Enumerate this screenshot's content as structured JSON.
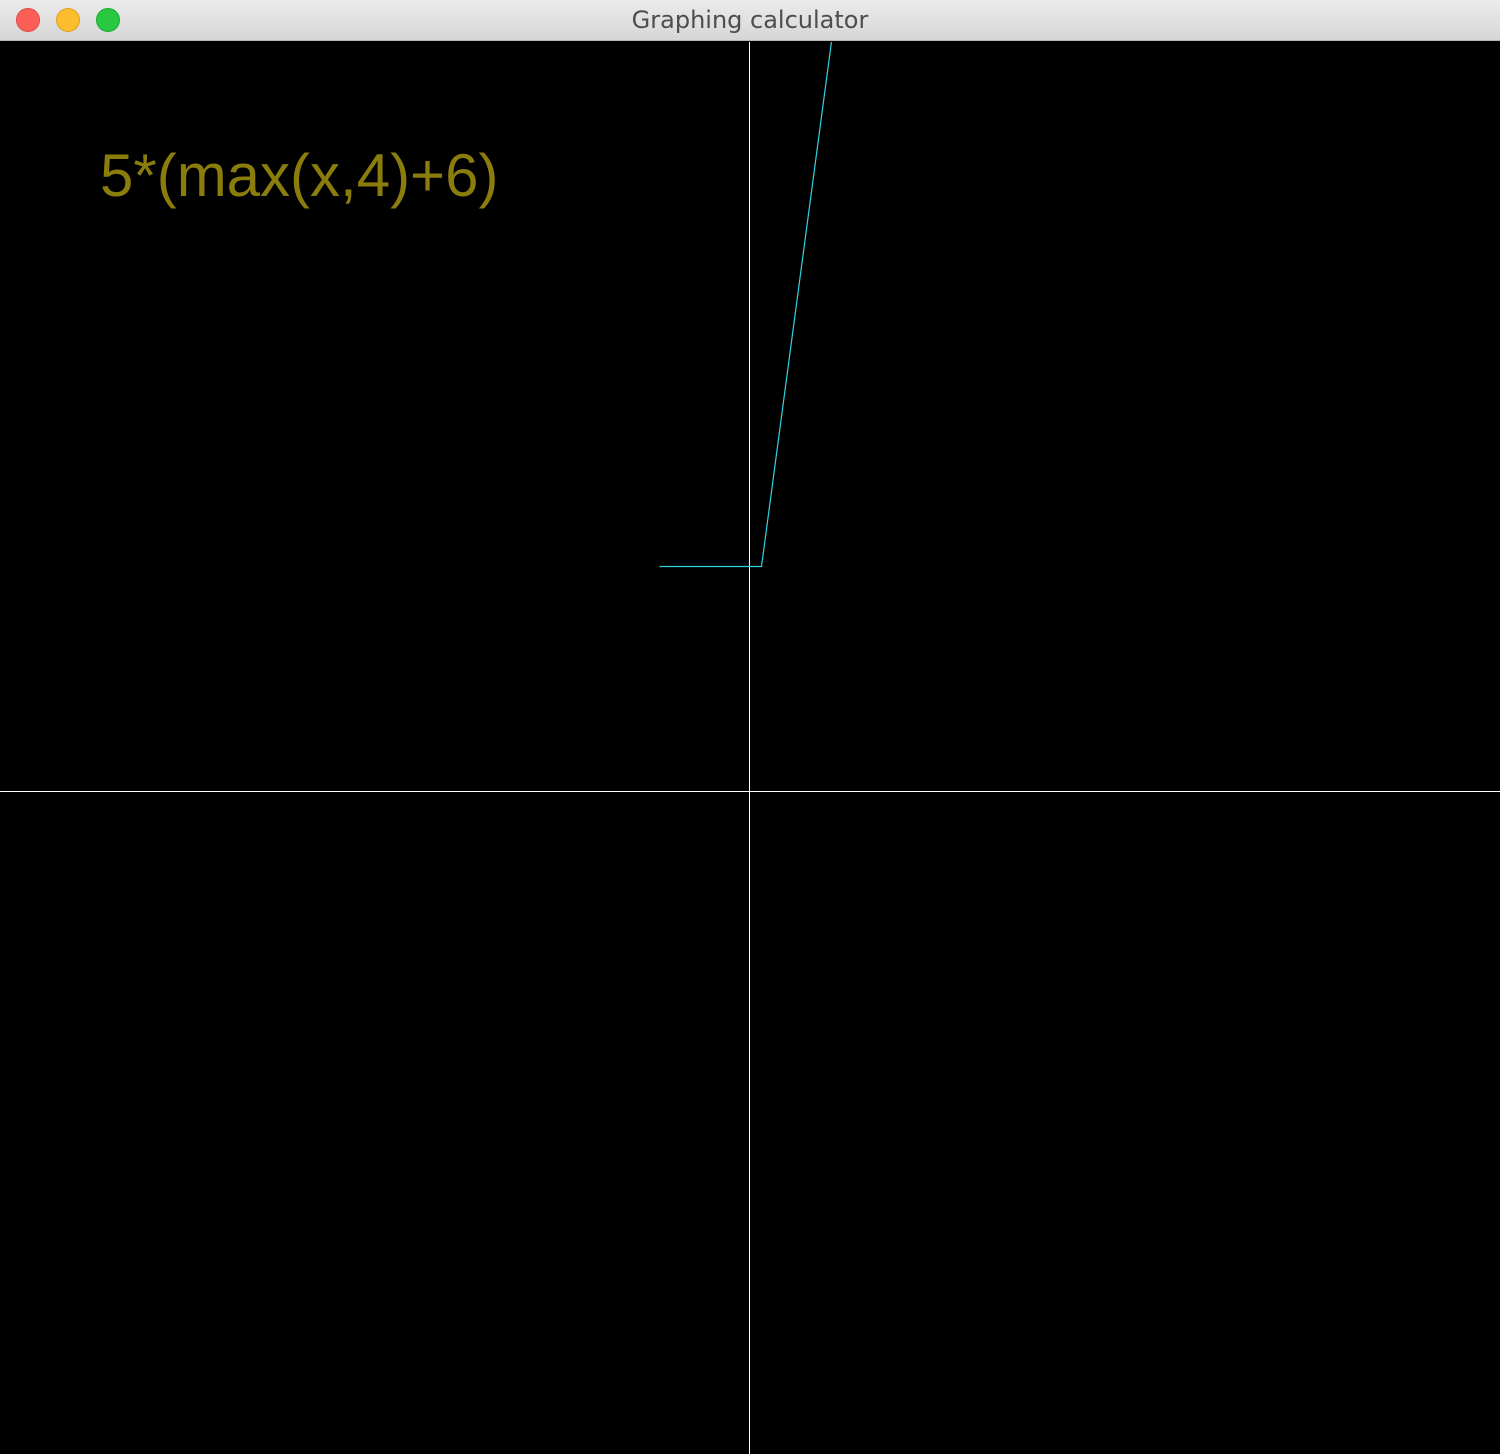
{
  "window": {
    "title": "Graphing calculator"
  },
  "graph": {
    "expression": "5*(max(x,4)+6)",
    "expression_color": "#8a7d0c",
    "curve_color": "#2fd3df",
    "axis_color": "#ffffff",
    "background_color": "#000000"
  },
  "chart_data": {
    "type": "line",
    "title": "5*(max(x,4)+6)",
    "xlabel": "",
    "ylabel": "",
    "grid": false,
    "series": [
      {
        "x": [
          -30,
          -29,
          -28,
          -27,
          -26,
          -25,
          -24,
          -23,
          -22,
          -21,
          -20,
          -19,
          -18,
          -17,
          -16,
          -15,
          -14,
          -13,
          -12,
          -11,
          -10,
          -9,
          -8,
          -7,
          -6,
          -5,
          -4,
          -3,
          -2,
          -1,
          0,
          1,
          2,
          3,
          4,
          5,
          6,
          7,
          8,
          9,
          10,
          11,
          12,
          13,
          14,
          15,
          16,
          17,
          18,
          19,
          20,
          21,
          22,
          23,
          24,
          25,
          26,
          27,
          28,
          29,
          30
        ],
        "y": [
          50,
          50,
          50,
          50,
          50,
          50,
          50,
          50,
          50,
          50,
          50,
          50,
          50,
          50,
          50,
          50,
          50,
          50,
          50,
          50,
          50,
          50,
          50,
          50,
          50,
          50,
          50,
          50,
          50,
          50,
          50,
          50,
          50,
          50,
          50,
          55,
          60,
          65,
          70,
          75,
          80,
          85,
          90,
          95,
          100,
          105,
          110,
          115,
          120,
          125,
          130,
          135,
          140,
          145,
          150,
          155,
          160,
          165,
          170,
          175,
          180
        ]
      }
    ]
  }
}
